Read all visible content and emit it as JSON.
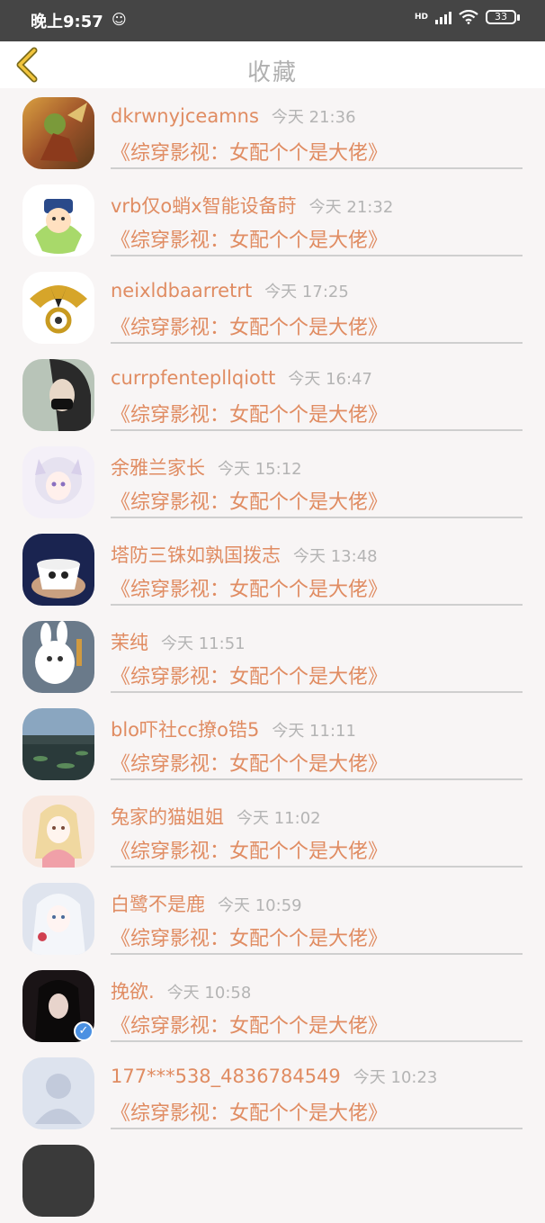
{
  "status_bar": {
    "time": "晚上9:57",
    "network": "HD",
    "battery": "33"
  },
  "header": {
    "title": "收藏"
  },
  "items": [
    {
      "name": "dkrwnyjceamns",
      "time": "今天 21:36",
      "work": "《综穿影视：女配个个是大佬》"
    },
    {
      "name": "vrb仅o蛸x智能设备莳",
      "time": "今天 21:32",
      "work": "《综穿影视：女配个个是大佬》"
    },
    {
      "name": "neixldbaarretrt",
      "time": "今天 17:25",
      "work": "《综穿影视：女配个个是大佬》"
    },
    {
      "name": "currpfentepllqiott",
      "time": "今天 16:47",
      "work": "《综穿影视：女配个个是大佬》"
    },
    {
      "name": "余雅兰家长",
      "time": "今天 15:12",
      "work": "《综穿影视：女配个个是大佬》"
    },
    {
      "name": "塔防三铢如孰国拨志",
      "time": "今天 13:48",
      "work": "《综穿影视：女配个个是大佬》"
    },
    {
      "name": "茉纯",
      "time": "今天 11:51",
      "work": "《综穿影视：女配个个是大佬》"
    },
    {
      "name": "blo吓社cc撩o锆5",
      "time": "今天 11:11",
      "work": "《综穿影视：女配个个是大佬》"
    },
    {
      "name": "兔家的猫姐姐",
      "time": "今天 11:02",
      "work": "《综穿影视：女配个个是大佬》"
    },
    {
      "name": "白鹭不是鹿",
      "time": "今天 10:59",
      "work": "《综穿影视：女配个个是大佬》"
    },
    {
      "name": "挽欲.",
      "time": "今天 10:58",
      "work": "《综穿影视：女配个个是大佬》"
    },
    {
      "name": "177***538_4836784549",
      "time": "今天 10:23",
      "work": "《综穿影视：女配个个是大佬》"
    }
  ]
}
